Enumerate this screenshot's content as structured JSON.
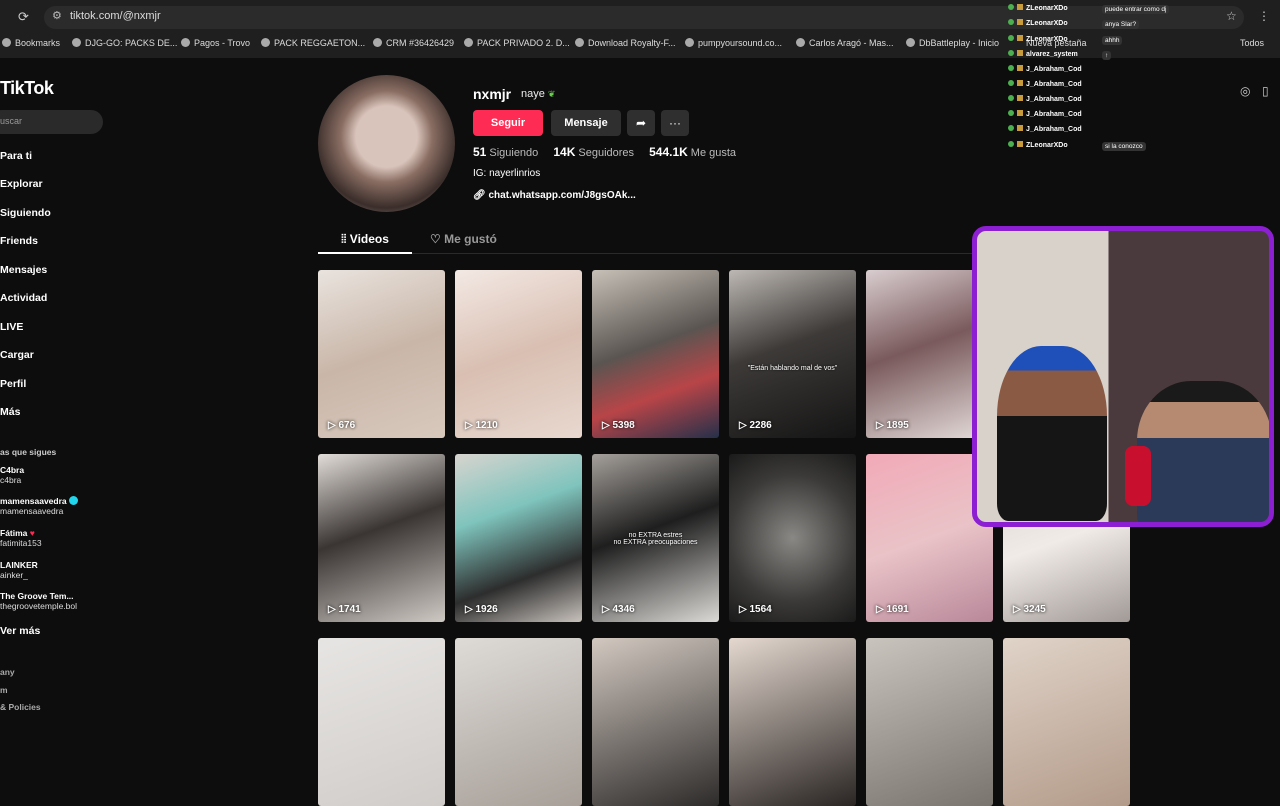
{
  "browser": {
    "url": "tiktok.com/@nxmjr",
    "bookmarks": [
      "Bookmarks",
      "DJG-GO: PACKS DE...",
      "Pagos - Trovo",
      "PACK REGGAETON...",
      "CRM #36426429",
      "PACK PRIVADO 2. D...",
      "Download Royalty-F...",
      "pumpyoursound.co...",
      "Carlos Aragó - Mas...",
      "DbBattleplay - Inicio",
      "Nueva pestaña",
      "Todos"
    ]
  },
  "sidebar": {
    "logo": "TikTok",
    "search_placeholder": "uscar",
    "nav": [
      "Para ti",
      "Explorar",
      "Siguiendo",
      "Friends",
      "Mensajes",
      "Actividad",
      "LIVE",
      "Cargar",
      "Perfil",
      "Más"
    ],
    "following_title": "as que sigues",
    "accounts": [
      {
        "name": "C4bra",
        "handle": "c4bra",
        "verified": false,
        "heart": false
      },
      {
        "name": "mamensaavedra",
        "handle": "mamensaavedra",
        "verified": true,
        "heart": false
      },
      {
        "name": "Fátima",
        "handle": "fatimita153",
        "verified": false,
        "heart": true
      },
      {
        "name": "LAINKER",
        "handle": "ainker_",
        "verified": false,
        "heart": false
      },
      {
        "name": "The Groove Tem...",
        "handle": "thegroovetemple.bol",
        "verified": false,
        "heart": false
      }
    ],
    "see_more": "Ver más",
    "footer": [
      "any",
      "m",
      "& Policies"
    ]
  },
  "profile": {
    "username": "nxmjr",
    "nickname": "naye",
    "follow_label": "Seguir",
    "message_label": "Mensaje",
    "following_count": "51",
    "following_label": "Siguiendo",
    "followers_count": "14K",
    "followers_label": "Seguidores",
    "likes_count": "544.1K",
    "likes_label": "Me gusta",
    "bio": "IG: nayerlinrios",
    "link": "chat.whatsapp.com/J8gsOAk..."
  },
  "tabs": {
    "videos": "Videos",
    "liked": "Me gustó"
  },
  "videos": [
    {
      "views": "676",
      "caption": ""
    },
    {
      "views": "1210",
      "caption": ""
    },
    {
      "views": "5398",
      "caption": ""
    },
    {
      "views": "2286",
      "caption": "\"Están hablando mal de vos\""
    },
    {
      "views": "1895",
      "caption": ""
    },
    {
      "views": "1741",
      "caption": ""
    },
    {
      "views": "1926",
      "caption": ""
    },
    {
      "views": "4346",
      "caption": "no EXTRA estres\nno EXTRA preocupaciones"
    },
    {
      "views": "1564",
      "caption": ""
    },
    {
      "views": "1691",
      "caption": ""
    },
    {
      "views": "3245",
      "caption": ""
    },
    {
      "views": "",
      "caption": ""
    },
    {
      "views": "",
      "caption": ""
    },
    {
      "views": "",
      "caption": ""
    },
    {
      "views": "",
      "caption": ""
    },
    {
      "views": "",
      "caption": ""
    },
    {
      "views": "",
      "caption": ""
    }
  ],
  "chat": [
    {
      "name": "ZLeonarXDo",
      "msg": "puede entrar como dj"
    },
    {
      "name": "ZLeonarXDo",
      "msg": "anya Slar?"
    },
    {
      "name": "ZLeonarXDo",
      "msg": "ahhh"
    },
    {
      "name": "alvarez_system",
      "msg": "↑"
    },
    {
      "name": "J_Abraham_Cod",
      "msg": ""
    },
    {
      "name": "J_Abraham_Cod",
      "msg": ""
    },
    {
      "name": "J_Abraham_Cod",
      "msg": ""
    },
    {
      "name": "J_Abraham_Cod",
      "msg": ""
    },
    {
      "name": "J_Abraham_Cod",
      "msg": ""
    },
    {
      "name": "ZLeonarXDo",
      "msg": "si la conozco"
    }
  ]
}
